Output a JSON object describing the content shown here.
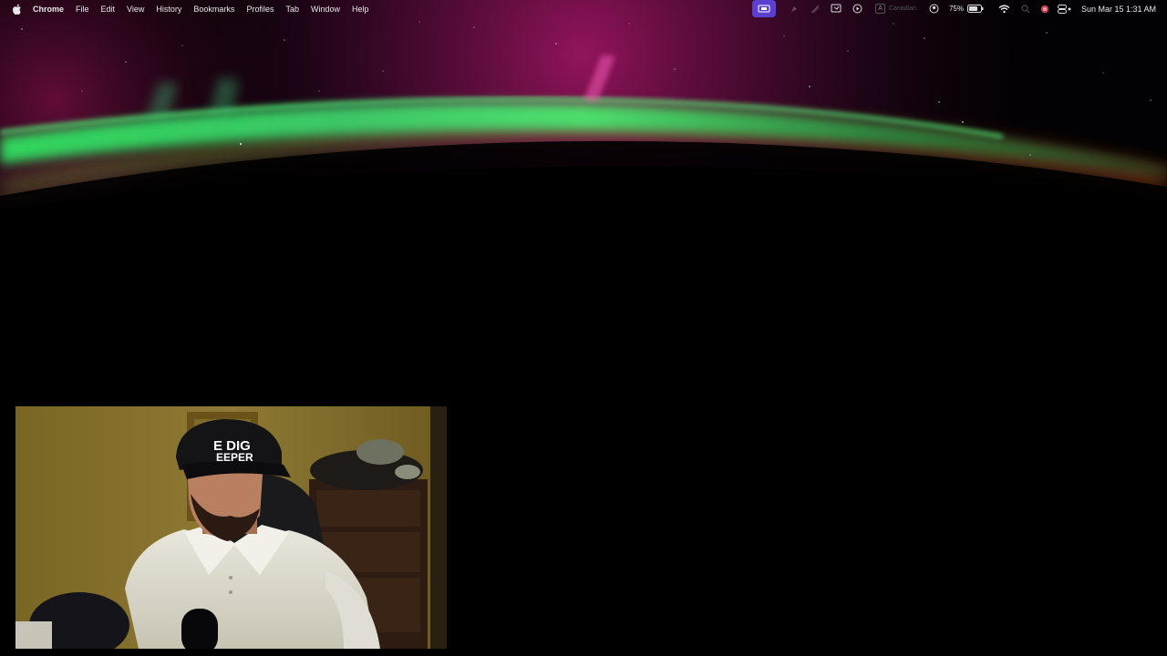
{
  "menubar": {
    "apple_icon": "apple-logo-icon",
    "app_name": "Chrome",
    "menus": [
      "File",
      "Edit",
      "View",
      "History",
      "Bookmarks",
      "Profiles",
      "Tab",
      "Window",
      "Help"
    ]
  },
  "status": {
    "keyboard_label": "Canadian",
    "battery_percent": "75%",
    "datetime": "Sun Mar 15  1:31 AM",
    "icons": [
      "screen-share-icon",
      "rocket-icon",
      "stage-manager-icon",
      "screen-record-icon",
      "play-icon",
      "keyboard-input-icon",
      "user-icon",
      "battery-icon",
      "wifi-icon",
      "search-icon",
      "account-dot-icon",
      "control-center-icon"
    ]
  },
  "webcam": {
    "cap_text_line1": "E DIG",
    "cap_text_line2": "EEPER"
  },
  "colors": {
    "accent_pill": "#5b3fd0",
    "aurora_green": "#3fd65a",
    "aurora_magenta": "#c8186a"
  }
}
